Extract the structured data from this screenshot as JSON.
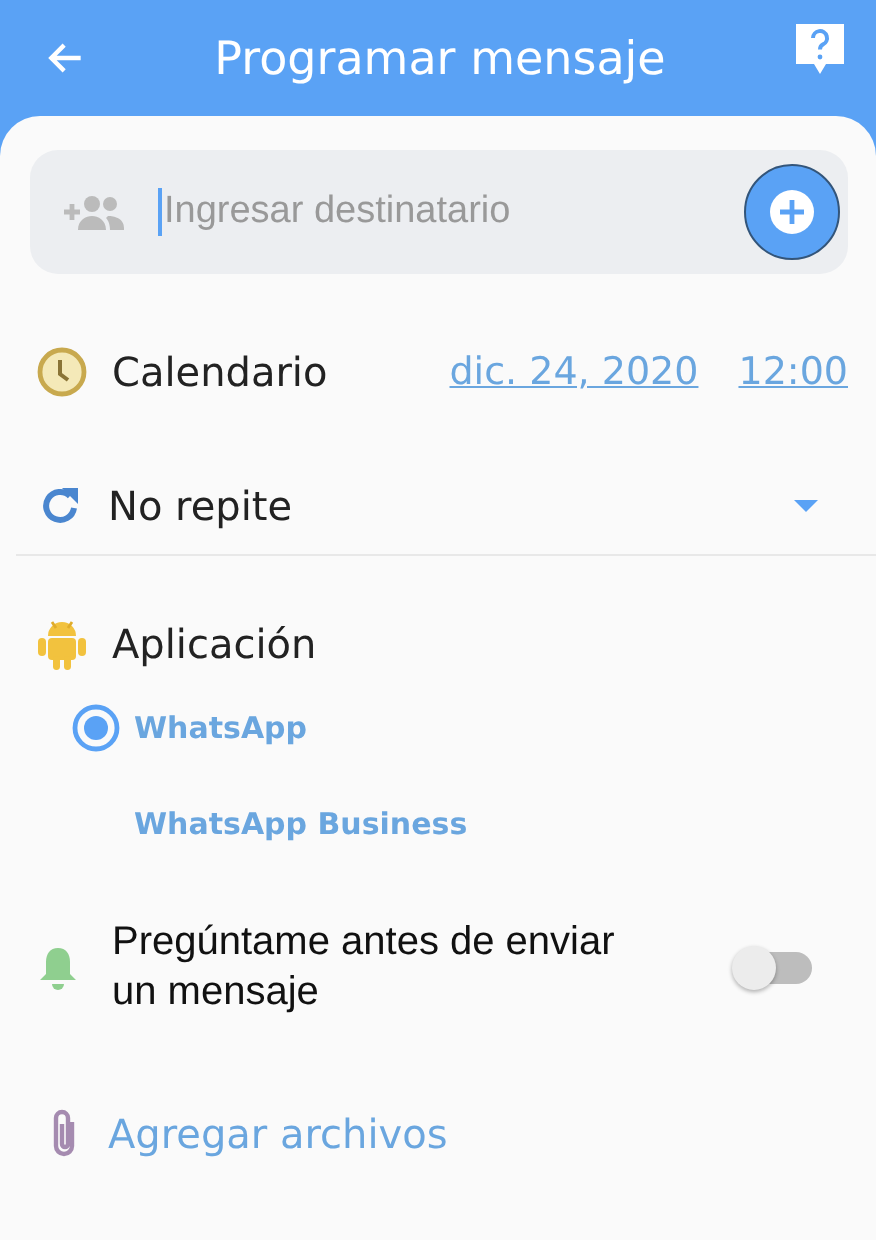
{
  "header": {
    "title": "Programar mensaje"
  },
  "recipient": {
    "placeholder": "Ingresar destinatario"
  },
  "schedule": {
    "label": "Calendario",
    "date": "dic. 24, 2020",
    "time": "12:00"
  },
  "repeat": {
    "value": "No repite"
  },
  "application": {
    "label": "Aplicación",
    "options": [
      {
        "label": "WhatsApp",
        "selected": true
      },
      {
        "label": "WhatsApp Business",
        "selected": false
      }
    ]
  },
  "confirm": {
    "label": "Pregúntame antes de enviar un mensaje",
    "on": false
  },
  "attach": {
    "label": "Agregar archivos"
  }
}
